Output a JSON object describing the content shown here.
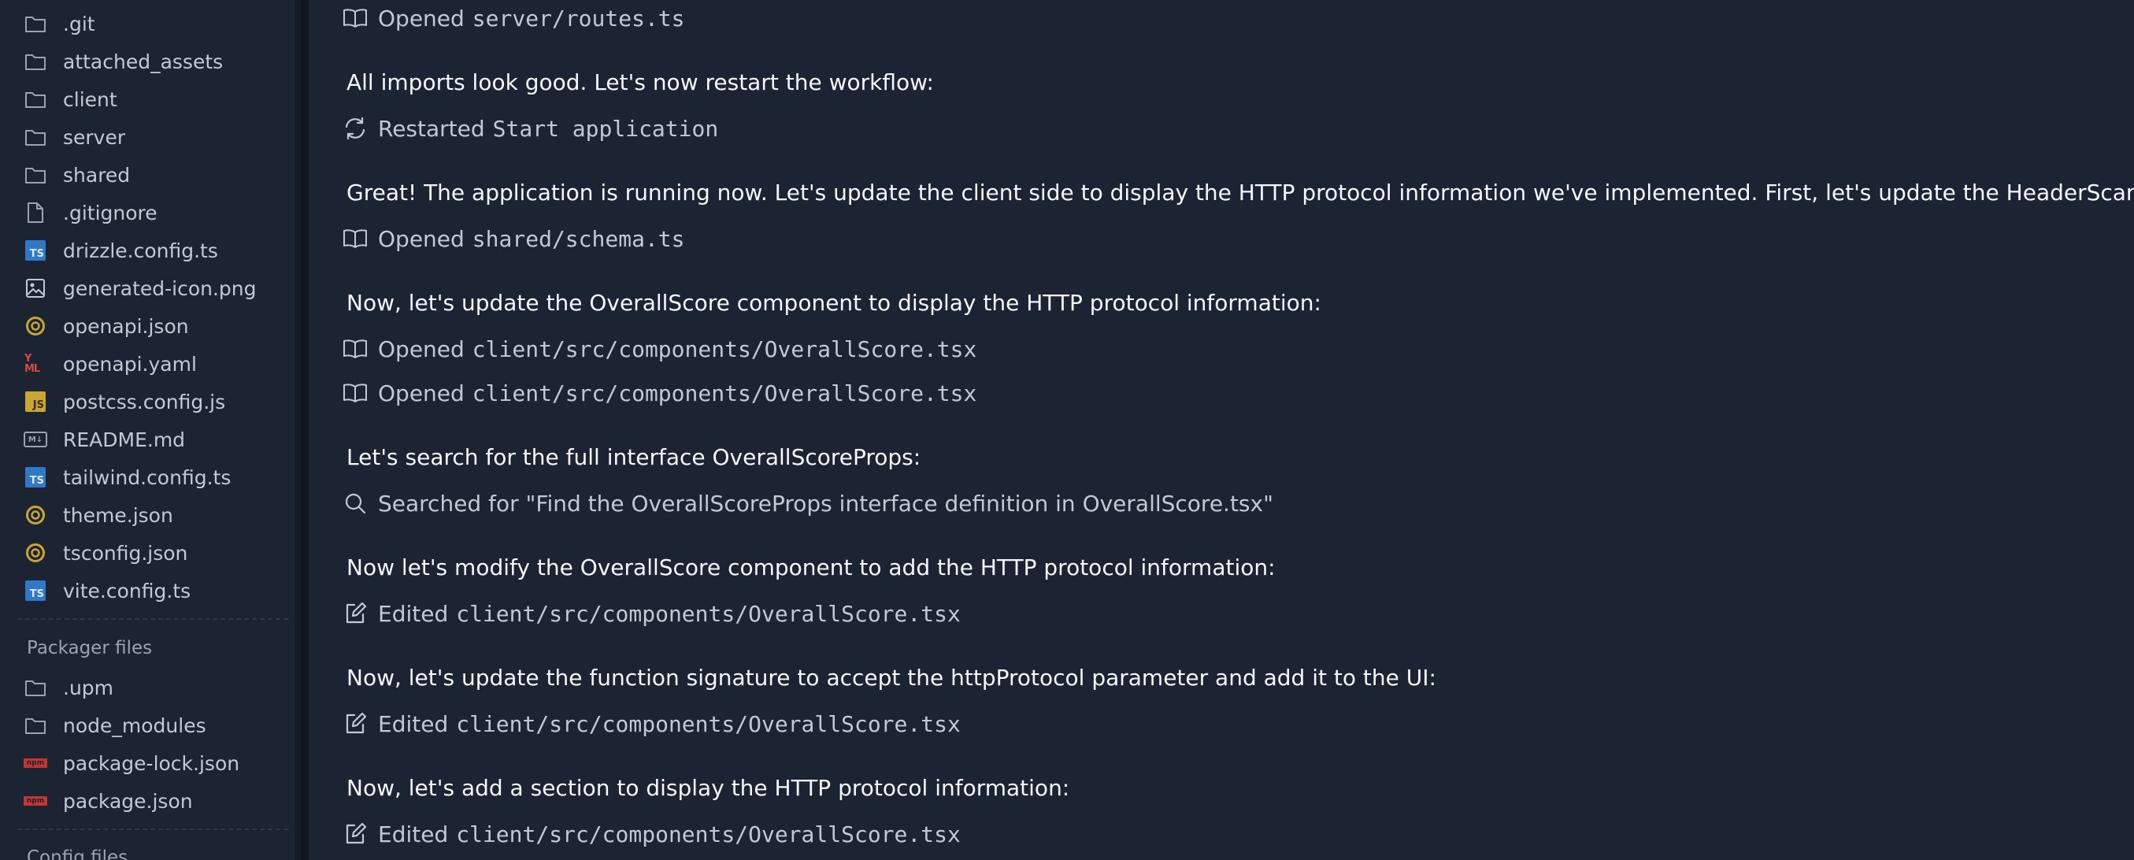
{
  "sidebar": {
    "files": [
      {
        "label": ".git",
        "icon": "folder-icon"
      },
      {
        "label": "attached_assets",
        "icon": "folder-icon"
      },
      {
        "label": "client",
        "icon": "folder-icon"
      },
      {
        "label": "server",
        "icon": "folder-icon"
      },
      {
        "label": "shared",
        "icon": "folder-icon"
      },
      {
        "label": ".gitignore",
        "icon": "file-icon"
      },
      {
        "label": "drizzle.config.ts",
        "icon": "typescript-icon",
        "badge": "TS"
      },
      {
        "label": "generated-icon.png",
        "icon": "image-icon"
      },
      {
        "label": "openapi.json",
        "icon": "json-icon"
      },
      {
        "label": "openapi.yaml",
        "icon": "yaml-icon",
        "badge": "YAML"
      },
      {
        "label": "postcss.config.js",
        "icon": "javascript-icon",
        "badge": "JS"
      },
      {
        "label": "README.md",
        "icon": "markdown-icon",
        "badge": "M↓"
      },
      {
        "label": "tailwind.config.ts",
        "icon": "typescript-icon",
        "badge": "TS"
      },
      {
        "label": "theme.json",
        "icon": "json-icon"
      },
      {
        "label": "tsconfig.json",
        "icon": "json-icon"
      },
      {
        "label": "vite.config.ts",
        "icon": "typescript-icon",
        "badge": "TS"
      }
    ],
    "packager_title": "Packager files",
    "packager_files": [
      {
        "label": ".upm",
        "icon": "folder-icon"
      },
      {
        "label": "node_modules",
        "icon": "folder-icon"
      },
      {
        "label": "package-lock.json",
        "icon": "npm-icon",
        "badge": "npm"
      },
      {
        "label": "package.json",
        "icon": "npm-icon",
        "badge": "npm"
      }
    ],
    "config_title": "Config files"
  },
  "chat": {
    "entries": [
      {
        "type": "action",
        "icon": "book-open-icon",
        "verb": "Opened",
        "path": "server/routes.ts"
      },
      {
        "type": "message",
        "text": "All imports look good. Let's now restart the workflow:"
      },
      {
        "type": "action",
        "icon": "restart-icon",
        "verb": "Restarted",
        "path": "Start application"
      },
      {
        "type": "message",
        "text": "Great! The application is running now. Let's update the client side to display the HTTP protocol information we've implemented. First, let's update the HeaderScan interface:"
      },
      {
        "type": "action",
        "icon": "book-open-icon",
        "verb": "Opened",
        "path": "shared/schema.ts"
      },
      {
        "type": "message",
        "text": "Now, let's update the OverallScore component to display the HTTP protocol information:"
      },
      {
        "type": "action",
        "icon": "book-open-icon",
        "verb": "Opened",
        "path": "client/src/components/OverallScore.tsx"
      },
      {
        "type": "action",
        "icon": "book-open-icon",
        "verb": "Opened",
        "path": "client/src/components/OverallScore.tsx"
      },
      {
        "type": "message",
        "text": "Let's search for the full interface OverallScoreProps:"
      },
      {
        "type": "search",
        "icon": "search-icon",
        "text": "Searched for \"Find the OverallScoreProps interface definition in OverallScore.tsx\""
      },
      {
        "type": "message",
        "text": "Now let's modify the OverallScore component to add the HTTP protocol information:"
      },
      {
        "type": "action",
        "icon": "edit-icon",
        "verb": "Edited",
        "path": "client/src/components/OverallScore.tsx"
      },
      {
        "type": "message",
        "text": "Now, let's update the function signature to accept the httpProtocol parameter and add it to the UI:"
      },
      {
        "type": "action",
        "icon": "edit-icon",
        "verb": "Edited",
        "path": "client/src/components/OverallScore.tsx"
      },
      {
        "type": "message",
        "text": "Now, let's add a section to display the HTTP protocol information:"
      },
      {
        "type": "action",
        "icon": "edit-icon",
        "verb": "Edited",
        "path": "client/src/components/OverallScore.tsx"
      }
    ]
  },
  "colors": {
    "background": "#1c2333",
    "text_primary": "#f5f7fa",
    "text_secondary": "#c2c8d4",
    "folder_icon": "#9aa3b2",
    "typescript": "#3178c6",
    "javascript": "#c9a531",
    "json": "#c9a531",
    "yaml": "#d84a40",
    "npm": "#c3352e"
  }
}
